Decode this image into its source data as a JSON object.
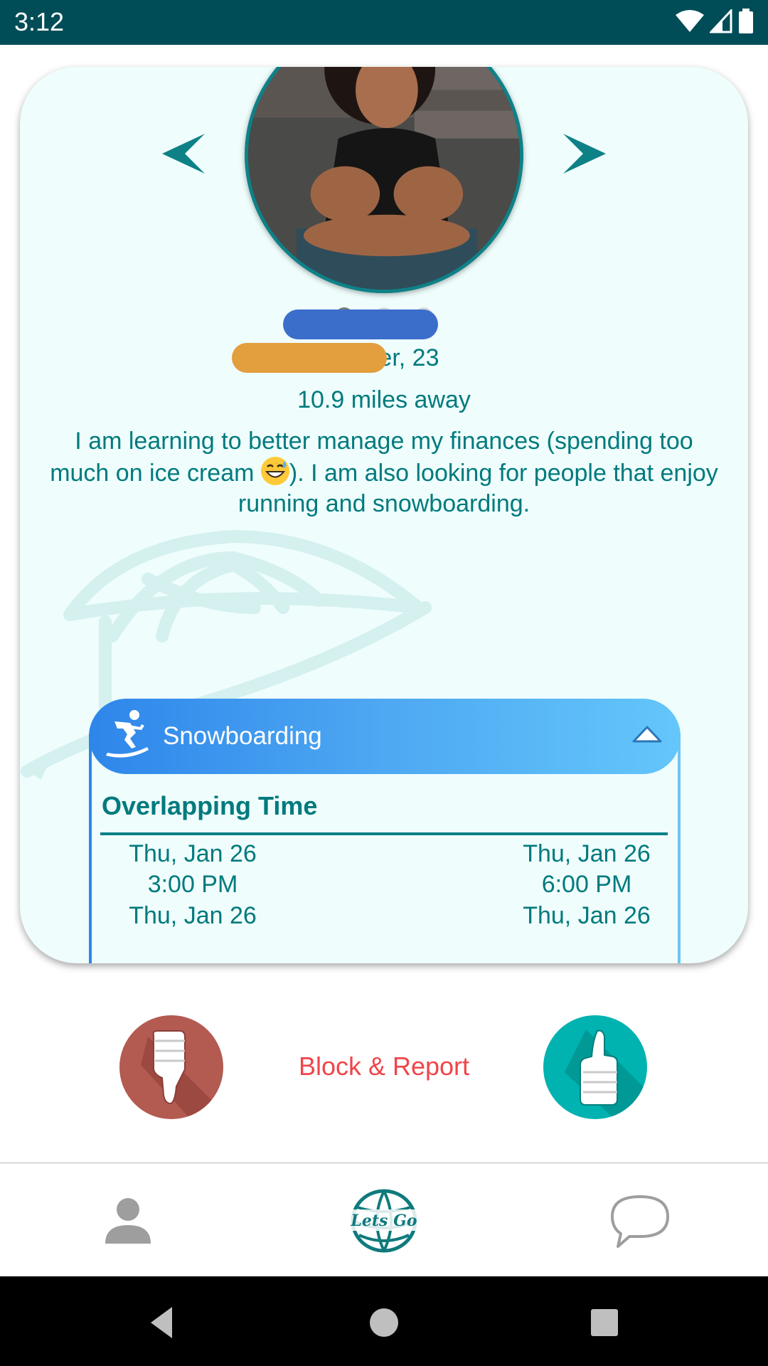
{
  "status_bar": {
    "time": "3:12",
    "icons": [
      "wifi-icon",
      "signal-icon",
      "battery-icon"
    ]
  },
  "profile": {
    "name_age": "Amber, 23",
    "distance": "10.9 miles away",
    "bio_part1": "I am learning to better manage my finances (spending too much on ice cream ",
    "bio_part2": "). I am also looking for people that enjoy running and snowboarding.",
    "photo_count": 3,
    "active_photo_index": 0
  },
  "activity": {
    "title": "Snowboarding",
    "icon": "snowboarder-icon",
    "overlap_heading": "Overlapping Time",
    "rows": [
      {
        "start_date": "Thu, Jan 26",
        "start_time": "3:00 PM",
        "end_date": "Thu, Jan 26",
        "end_time": "6:00 PM"
      },
      {
        "start_date": "Thu, Jan 26",
        "end_date": "Thu, Jan 26"
      }
    ],
    "bar_colors": [
      "#3b6ecb",
      "#e39e3e"
    ]
  },
  "actions": {
    "block_report": "Block & Report",
    "dislike_icon": "thumbs-down-icon",
    "like_icon": "thumbs-up-icon"
  },
  "bottom_nav": {
    "items": [
      "profile-icon",
      "lets-go-logo",
      "chat-bubble-icon"
    ],
    "logo_text": "Lets Go"
  },
  "colors": {
    "teal_text": "#007a7d",
    "status_bar": "#004d57",
    "card_bg": "#effdfd",
    "danger": "#f0454a",
    "dislike": "#b35a51",
    "like": "#00b2b0"
  }
}
